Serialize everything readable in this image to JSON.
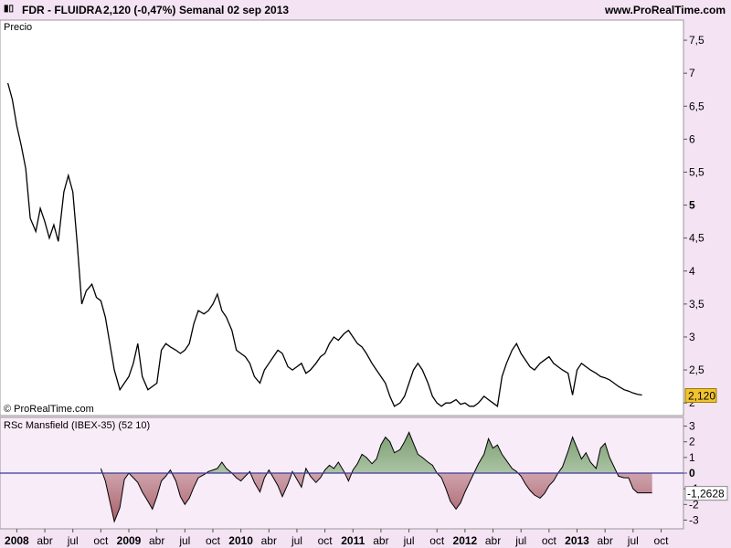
{
  "header": {
    "symbol": "FDR - FLUIDRA",
    "price_change": "2,120 (-0,47%)",
    "period_date": "Semanal  02 sep 2013",
    "site": "www.ProRealTime.com"
  },
  "chart_data": [
    {
      "type": "line",
      "title": "Precio",
      "copyright": "© ProRealTime.com",
      "y_ticks": [
        {
          "v": 7.5,
          "label": "7,5",
          "bold": false
        },
        {
          "v": 7,
          "label": "7",
          "bold": false
        },
        {
          "v": 6.5,
          "label": "6,5",
          "bold": false
        },
        {
          "v": 6,
          "label": "6",
          "bold": false
        },
        {
          "v": 5.5,
          "label": "5,5",
          "bold": false
        },
        {
          "v": 5,
          "label": "5",
          "bold": true
        },
        {
          "v": 4.5,
          "label": "4,5",
          "bold": false
        },
        {
          "v": 4,
          "label": "4",
          "bold": false
        },
        {
          "v": 3.5,
          "label": "3,5",
          "bold": false
        },
        {
          "v": 3,
          "label": "3",
          "bold": false
        },
        {
          "v": 2.5,
          "label": "2,5",
          "bold": false
        },
        {
          "v": 2,
          "label": "2",
          "bold": false
        }
      ],
      "ylim": [
        1.85,
        7.75
      ],
      "last_value": 2.12,
      "last_label": "2,120",
      "x": [
        2007.92,
        2007.96,
        2008.0,
        2008.04,
        2008.08,
        2008.12,
        2008.17,
        2008.21,
        2008.25,
        2008.29,
        2008.33,
        2008.37,
        2008.42,
        2008.46,
        2008.5,
        2008.54,
        2008.58,
        2008.62,
        2008.67,
        2008.71,
        2008.75,
        2008.79,
        2008.83,
        2008.87,
        2008.92,
        2008.96,
        2009.0,
        2009.04,
        2009.08,
        2009.12,
        2009.17,
        2009.21,
        2009.25,
        2009.29,
        2009.33,
        2009.37,
        2009.42,
        2009.46,
        2009.5,
        2009.54,
        2009.58,
        2009.62,
        2009.67,
        2009.71,
        2009.75,
        2009.79,
        2009.83,
        2009.87,
        2009.92,
        2009.96,
        2010.0,
        2010.04,
        2010.08,
        2010.12,
        2010.17,
        2010.21,
        2010.25,
        2010.29,
        2010.33,
        2010.37,
        2010.42,
        2010.46,
        2010.5,
        2010.54,
        2010.58,
        2010.62,
        2010.67,
        2010.71,
        2010.75,
        2010.79,
        2010.83,
        2010.87,
        2010.92,
        2010.96,
        2011.0,
        2011.04,
        2011.08,
        2011.12,
        2011.17,
        2011.21,
        2011.25,
        2011.29,
        2011.33,
        2011.37,
        2011.42,
        2011.46,
        2011.5,
        2011.54,
        2011.58,
        2011.62,
        2011.67,
        2011.71,
        2011.75,
        2011.79,
        2011.83,
        2011.87,
        2011.92,
        2011.96,
        2012.0,
        2012.04,
        2012.08,
        2012.12,
        2012.17,
        2012.21,
        2012.25,
        2012.29,
        2012.33,
        2012.37,
        2012.42,
        2012.46,
        2012.5,
        2012.54,
        2012.58,
        2012.62,
        2012.67,
        2012.71,
        2012.75,
        2012.79,
        2012.83,
        2012.87,
        2012.92,
        2012.96,
        2013.0,
        2013.04,
        2013.08,
        2013.12,
        2013.17,
        2013.21,
        2013.25,
        2013.29,
        2013.33,
        2013.37,
        2013.42,
        2013.46,
        2013.5,
        2013.54,
        2013.58,
        2013.62,
        2013.67
      ],
      "y": [
        6.85,
        6.6,
        6.2,
        5.9,
        5.55,
        4.8,
        4.6,
        4.95,
        4.75,
        4.5,
        4.7,
        4.45,
        5.2,
        5.45,
        5.2,
        4.4,
        3.5,
        3.7,
        3.8,
        3.6,
        3.55,
        3.3,
        2.9,
        2.5,
        2.2,
        2.3,
        2.4,
        2.6,
        2.9,
        2.4,
        2.2,
        2.25,
        2.3,
        2.8,
        2.9,
        2.85,
        2.8,
        2.75,
        2.8,
        2.9,
        3.2,
        3.4,
        3.35,
        3.4,
        3.5,
        3.65,
        3.4,
        3.3,
        3.1,
        2.8,
        2.75,
        2.7,
        2.6,
        2.4,
        2.3,
        2.5,
        2.6,
        2.7,
        2.8,
        2.75,
        2.55,
        2.5,
        2.55,
        2.6,
        2.45,
        2.5,
        2.6,
        2.7,
        2.75,
        2.9,
        3.0,
        2.95,
        3.05,
        3.1,
        3.0,
        2.9,
        2.85,
        2.75,
        2.6,
        2.5,
        2.4,
        2.3,
        2.1,
        1.95,
        2.0,
        2.1,
        2.3,
        2.5,
        2.6,
        2.5,
        2.3,
        2.1,
        2.0,
        1.95,
        2.0,
        2.0,
        2.05,
        1.98,
        2.0,
        1.95,
        1.95,
        2.0,
        2.1,
        2.05,
        2.0,
        1.95,
        2.4,
        2.6,
        2.8,
        2.9,
        2.75,
        2.65,
        2.55,
        2.5,
        2.6,
        2.65,
        2.7,
        2.6,
        2.55,
        2.5,
        2.45,
        2.12,
        2.5,
        2.6,
        2.55,
        2.5,
        2.45,
        2.4,
        2.38,
        2.35,
        2.3,
        2.25,
        2.2,
        2.18,
        2.15,
        2.13,
        2.12
      ]
    },
    {
      "type": "area",
      "title": "RSc Mansfield (IBEX-35) (52 10)",
      "y_ticks": [
        {
          "v": 3,
          "label": "3",
          "bold": false
        },
        {
          "v": 2,
          "label": "2",
          "bold": false
        },
        {
          "v": 1,
          "label": "1",
          "bold": false
        },
        {
          "v": 0,
          "label": "0",
          "bold": true
        },
        {
          "v": -1,
          "label": "-1",
          "bold": false
        },
        {
          "v": -2,
          "label": "-2",
          "bold": false
        },
        {
          "v": -3,
          "label": "-3",
          "bold": false
        }
      ],
      "ylim": [
        -3.5,
        3.5
      ],
      "last_value": -1.2628,
      "last_label": "-1,2628",
      "x": [
        2008.75,
        2008.79,
        2008.83,
        2008.87,
        2008.92,
        2008.96,
        2009.0,
        2009.04,
        2009.08,
        2009.12,
        2009.17,
        2009.21,
        2009.25,
        2009.29,
        2009.33,
        2009.37,
        2009.42,
        2009.46,
        2009.5,
        2009.54,
        2009.58,
        2009.62,
        2009.67,
        2009.71,
        2009.75,
        2009.79,
        2009.83,
        2009.87,
        2009.92,
        2009.96,
        2010.0,
        2010.04,
        2010.08,
        2010.12,
        2010.17,
        2010.21,
        2010.25,
        2010.29,
        2010.33,
        2010.37,
        2010.42,
        2010.46,
        2010.5,
        2010.54,
        2010.58,
        2010.62,
        2010.67,
        2010.71,
        2010.75,
        2010.79,
        2010.83,
        2010.87,
        2010.92,
        2010.96,
        2011.0,
        2011.04,
        2011.08,
        2011.12,
        2011.17,
        2011.21,
        2011.25,
        2011.29,
        2011.33,
        2011.37,
        2011.42,
        2011.46,
        2011.5,
        2011.54,
        2011.58,
        2011.62,
        2011.67,
        2011.71,
        2011.75,
        2011.79,
        2011.83,
        2011.87,
        2011.92,
        2011.96,
        2012.0,
        2012.04,
        2012.08,
        2012.12,
        2012.17,
        2012.21,
        2012.25,
        2012.29,
        2012.33,
        2012.37,
        2012.42,
        2012.46,
        2012.5,
        2012.54,
        2012.58,
        2012.62,
        2012.67,
        2012.71,
        2012.75,
        2012.79,
        2012.83,
        2012.87,
        2012.92,
        2012.96,
        2013.0,
        2013.04,
        2013.08,
        2013.12,
        2013.17,
        2013.21,
        2013.25,
        2013.29,
        2013.33,
        2013.37,
        2013.42,
        2013.46,
        2013.5,
        2013.54,
        2013.58,
        2013.62,
        2013.67
      ],
      "y": [
        0.3,
        -0.5,
        -1.8,
        -3.1,
        -2.2,
        -0.4,
        0.0,
        -0.3,
        -0.6,
        -1.2,
        -1.8,
        -2.3,
        -1.5,
        -0.5,
        -0.2,
        0.2,
        -0.5,
        -1.5,
        -2.0,
        -1.6,
        -0.9,
        -0.3,
        -0.1,
        0.1,
        0.2,
        0.3,
        0.7,
        0.3,
        0.0,
        -0.3,
        -0.5,
        -0.2,
        0.1,
        -0.6,
        -1.2,
        -0.3,
        0.2,
        -0.3,
        -0.8,
        -1.5,
        -0.7,
        0.1,
        -0.4,
        -0.9,
        0.3,
        -0.2,
        -0.6,
        -0.3,
        0.2,
        0.5,
        0.3,
        0.7,
        0.1,
        -0.5,
        0.2,
        0.6,
        1.2,
        1.0,
        0.6,
        0.9,
        1.8,
        2.3,
        2.0,
        1.3,
        1.5,
        2.0,
        2.6,
        1.9,
        1.2,
        1.0,
        0.7,
        0.5,
        0.0,
        -0.3,
        -1.0,
        -1.8,
        -2.3,
        -1.9,
        -1.2,
        -0.6,
        0.0,
        0.6,
        1.2,
        2.2,
        1.6,
        1.8,
        1.2,
        0.8,
        0.3,
        0.1,
        -0.2,
        -0.7,
        -1.1,
        -1.4,
        -1.6,
        -1.3,
        -0.8,
        -0.5,
        0.0,
        0.4,
        1.4,
        2.3,
        1.6,
        0.9,
        1.3,
        0.7,
        0.3,
        1.6,
        1.9,
        1.0,
        0.4,
        -0.2,
        -0.3,
        -0.3,
        -1.0,
        -1.26,
        -1.26,
        -1.26,
        -1.26
      ]
    }
  ],
  "x_ticks": [
    {
      "v": 2008.0,
      "label": "2008",
      "bold": true
    },
    {
      "v": 2008.25,
      "label": "abr",
      "bold": false
    },
    {
      "v": 2008.5,
      "label": "jul",
      "bold": false
    },
    {
      "v": 2008.75,
      "label": "oct",
      "bold": false
    },
    {
      "v": 2009.0,
      "label": "2009",
      "bold": true
    },
    {
      "v": 2009.25,
      "label": "abr",
      "bold": false
    },
    {
      "v": 2009.5,
      "label": "jul",
      "bold": false
    },
    {
      "v": 2009.75,
      "label": "oct",
      "bold": false
    },
    {
      "v": 2010.0,
      "label": "2010",
      "bold": true
    },
    {
      "v": 2010.25,
      "label": "abr",
      "bold": false
    },
    {
      "v": 2010.5,
      "label": "jul",
      "bold": false
    },
    {
      "v": 2010.75,
      "label": "oct",
      "bold": false
    },
    {
      "v": 2011.0,
      "label": "2011",
      "bold": true
    },
    {
      "v": 2011.25,
      "label": "abr",
      "bold": false
    },
    {
      "v": 2011.5,
      "label": "jul",
      "bold": false
    },
    {
      "v": 2011.75,
      "label": "oct",
      "bold": false
    },
    {
      "v": 2012.0,
      "label": "2012",
      "bold": true
    },
    {
      "v": 2012.25,
      "label": "abr",
      "bold": false
    },
    {
      "v": 2012.5,
      "label": "jul",
      "bold": false
    },
    {
      "v": 2012.75,
      "label": "oct",
      "bold": false
    },
    {
      "v": 2013.0,
      "label": "2013",
      "bold": true
    },
    {
      "v": 2013.25,
      "label": "abr",
      "bold": false
    },
    {
      "v": 2013.5,
      "label": "jul",
      "bold": false
    },
    {
      "v": 2013.75,
      "label": "oct",
      "bold": false
    }
  ],
  "xlim": [
    2007.85,
    2013.95
  ],
  "colors": {
    "background": "#f3e3f3",
    "plot_bg": "#ffffff",
    "indicator_bg": "#f8ecf8",
    "price_line": "#000000",
    "zero_line": "#3a3a9a",
    "positive_fill": "#7a9e70",
    "negative_fill": "#a8606a",
    "price_badge": "#f0c430"
  }
}
